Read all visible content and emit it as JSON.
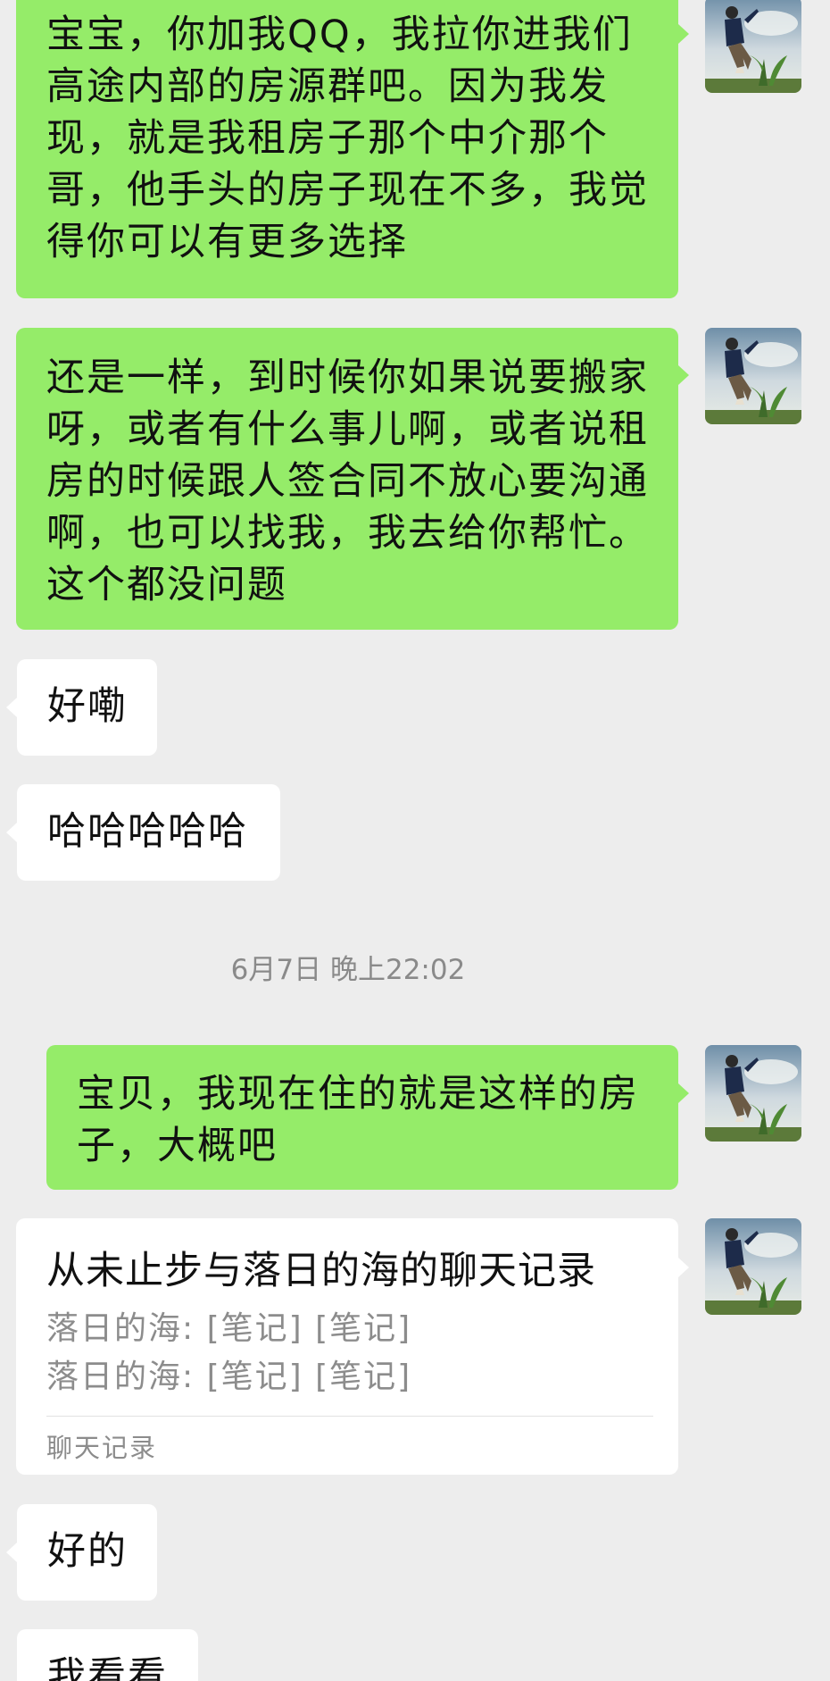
{
  "messages": [
    {
      "sender": "me",
      "text": "宝宝，你加我QQ，我拉你进我们高途内部的房源群吧。因为我发现，就是我租房子那个中介那个哥，他手头的房子现在不多，我觉得你可以有更多选择"
    },
    {
      "sender": "me",
      "text": "还是一样，到时候你如果说要搬家呀，或者有什么事儿啊，或者说租房的时候跟人签合同不放心要沟通啊，也可以找我，我去给你帮忙。这个都没问题"
    },
    {
      "sender": "other",
      "text": "好嘞"
    },
    {
      "sender": "other",
      "text": "哈哈哈哈哈"
    },
    {
      "sender": "me",
      "text": "宝贝，我现在住的就是这样的房子，大概吧"
    },
    {
      "sender": "other",
      "text": "好的"
    },
    {
      "sender": "other",
      "text": "我看看"
    }
  ],
  "timestamp": "6月7日 晚上22:02",
  "chat_record_card": {
    "title": "从未止步与落日的海的聊天记录",
    "lines": [
      "落日的海: [笔记] [笔记]",
      "落日的海: [笔记] [笔记]"
    ],
    "footer": "聊天记录"
  },
  "colors": {
    "background": "#ededed",
    "my_bubble": "#95ec69",
    "other_bubble": "#ffffff",
    "meta_text": "#8a8a8a"
  },
  "icons": {
    "avatar": "avatar-photo-jumping-person"
  }
}
